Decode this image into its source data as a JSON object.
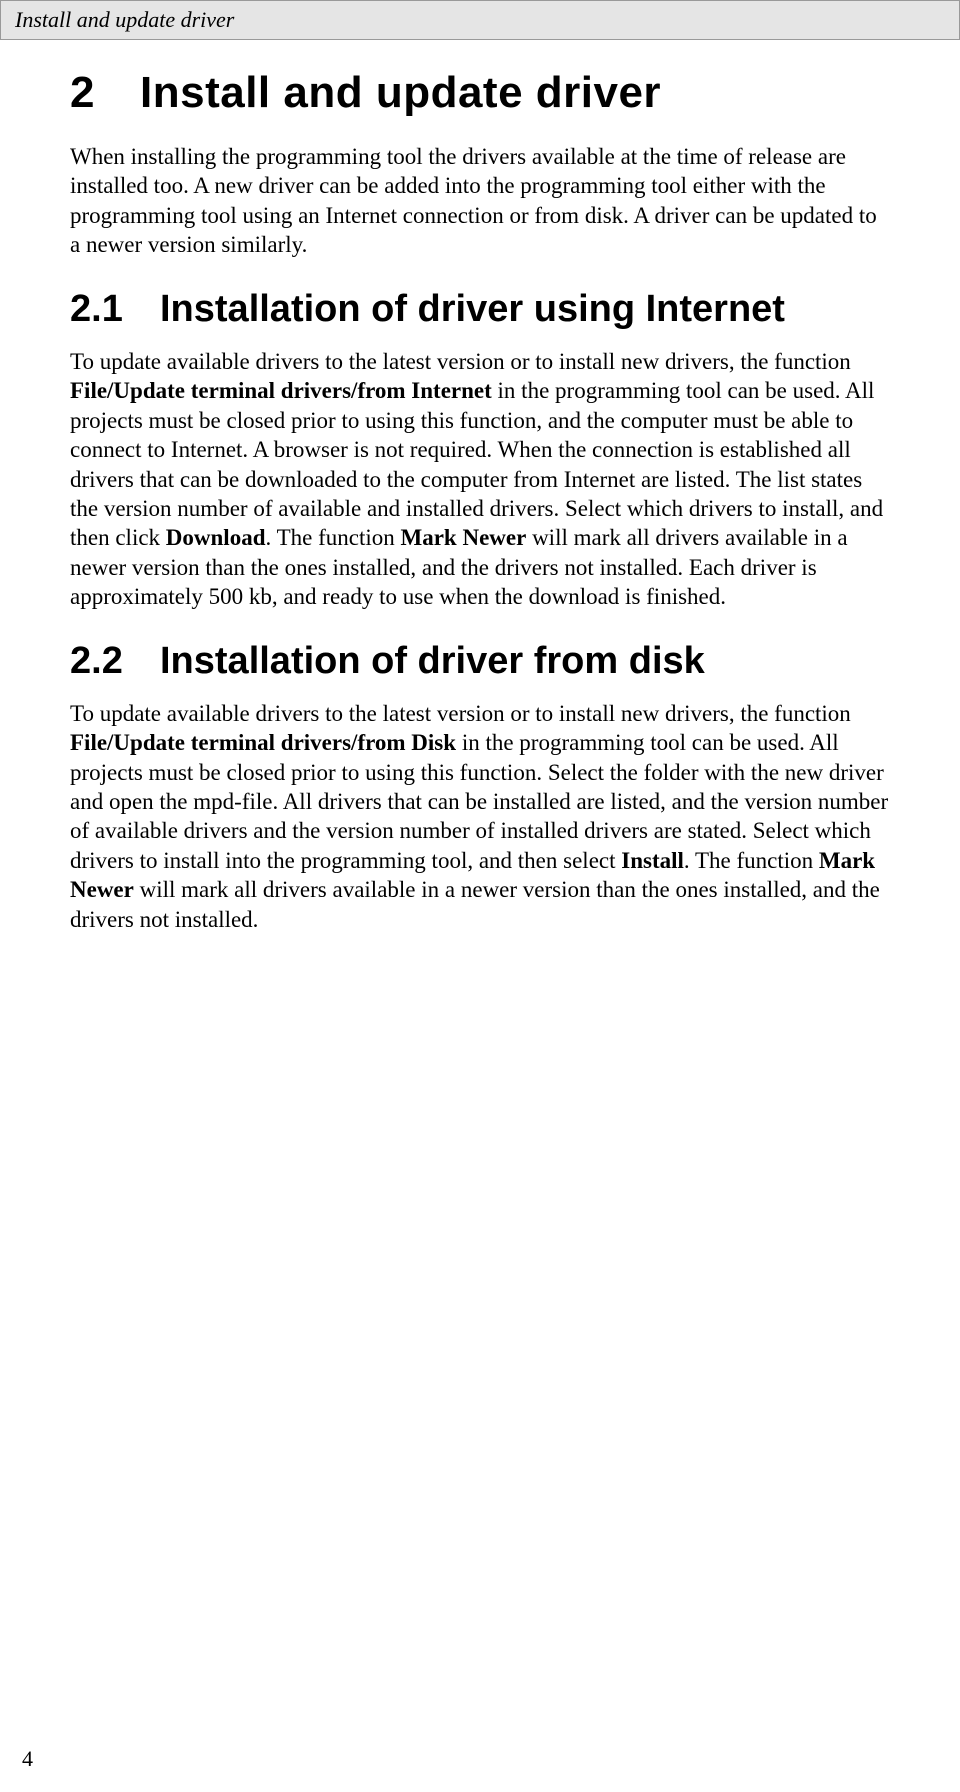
{
  "header": {
    "running_title": "Install and update driver"
  },
  "chapter": {
    "number": "2",
    "title": "Install and update driver"
  },
  "intro_text": "When installing the programming tool the drivers available at the time of release are installed too. A new driver can be added into the programming tool either with the programming tool using an Internet connection or from disk. A driver can be updated to a newer version similarly.",
  "section1": {
    "number": "2.1",
    "title": "Installation of driver using Internet",
    "p1a": "To update available drivers to the latest version or to install new drivers, the function ",
    "p1b_bold": "File/Update terminal drivers/from Internet",
    "p1c": " in the programming tool can be used. All projects must be closed prior to using this function, and the computer must be able to connect to Internet. A browser is not required. When the connection is established all drivers that can be downloaded to the computer from Internet are listed. The list states the version number of available and installed drivers. Select which drivers to install, and then click ",
    "p1d_bold": "Download",
    "p1e": ". The function ",
    "p1f_bold": "Mark Newer",
    "p1g": " will mark all drivers available in a newer version than the ones installed, and the drivers not installed. Each driver is approximately 500 kb, and ready to use when the download is finished."
  },
  "section2": {
    "number": "2.2",
    "title": "Installation of driver from disk",
    "p1a": "To update available drivers to the latest version or to install new drivers, the function ",
    "p1b_bold": "File/Update terminal drivers/from Disk",
    "p1c": " in the programming tool can be used. All projects must be closed prior to using this function. Select the folder with the new driver and open the mpd-file. All drivers that can be installed are listed, and the version number of available drivers and the version number of installed drivers are stated. Select which drivers to install into the programming tool, and then select ",
    "p1d_bold": "Install",
    "p1e": ". The function ",
    "p1f_bold": "Mark Newer",
    "p1g": " will mark all drivers available in a newer version than the ones installed, and the drivers not installed."
  },
  "page_number": "4"
}
